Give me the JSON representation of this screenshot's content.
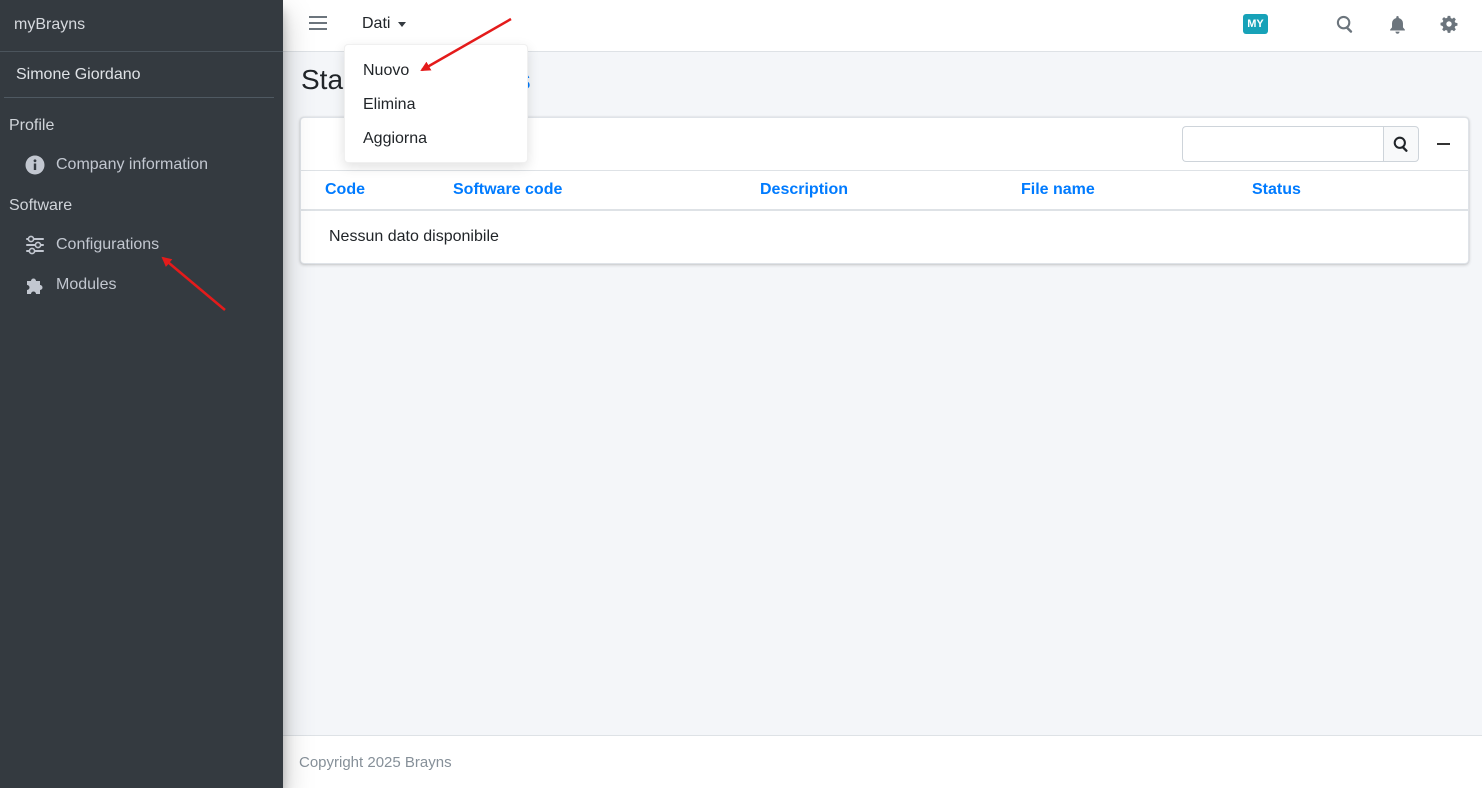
{
  "sidebar": {
    "brand": "myBrayns",
    "user_name": "Simone Giordano",
    "sections": [
      {
        "header": "Profile",
        "items": [
          {
            "label": "Company information",
            "icon": "info-circle-icon"
          }
        ]
      },
      {
        "header": "Software",
        "items": [
          {
            "label": "Configurations",
            "icon": "sliders-icon"
          },
          {
            "label": "Modules",
            "icon": "puzzle-icon"
          }
        ]
      }
    ]
  },
  "topbar": {
    "menu_label": "Dati",
    "badge": "MY",
    "icons": [
      "search-icon",
      "bell-icon",
      "gear-icon"
    ]
  },
  "dropdown": {
    "items": [
      "Nuovo",
      "Elimina",
      "Aggiorna"
    ]
  },
  "page": {
    "title_visible_left": "Sta",
    "title_visible_right": "ns"
  },
  "table": {
    "search_placeholder": "",
    "columns": [
      "Code",
      "Software code",
      "Description",
      "File name",
      "Status"
    ],
    "empty_message": "Nessun dato disponibile"
  },
  "footer": {
    "copyright": "Copyright 2025 Brayns"
  },
  "colors": {
    "sidebar_bg": "#343a40",
    "link_blue": "#007bff",
    "badge_teal": "#17a2b8",
    "annotation_red": "#e41b1b"
  }
}
